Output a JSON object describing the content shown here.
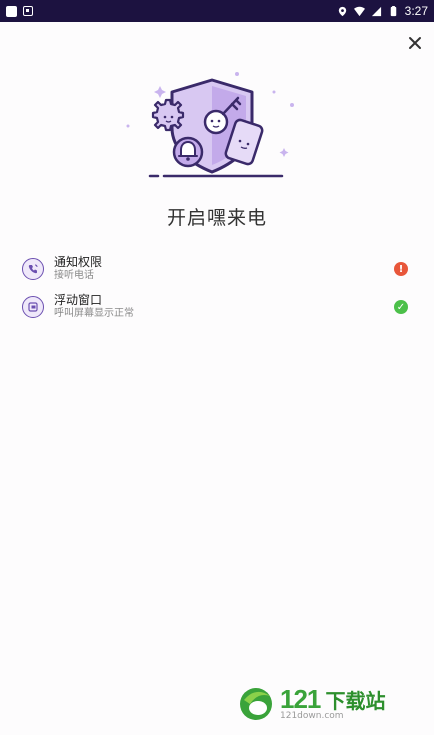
{
  "status_bar": {
    "time": "3:27"
  },
  "close": {
    "label": "×"
  },
  "title": "开启嘿来电",
  "permissions": [
    {
      "title": "通知权限",
      "subtitle": "接听电话",
      "status": "error",
      "status_glyph": "!"
    },
    {
      "title": "浮动窗口",
      "subtitle": "呼叫屏幕显示正常",
      "status": "ok",
      "status_glyph": "✓"
    }
  ],
  "watermark": {
    "brand_number": "121",
    "brand_cn": "下载站",
    "url": "121down.com"
  },
  "colors": {
    "status_bar_bg": "#1c1240",
    "accent_purple": "#6b4fb0",
    "light_purple": "#d8c8f2",
    "error_red": "#e8563a",
    "ok_green": "#4cc04a",
    "watermark_green": "#3aa33a"
  },
  "icons": {
    "close": "close-icon",
    "perm1": "phone-ring-icon",
    "perm2": "floating-window-icon"
  }
}
